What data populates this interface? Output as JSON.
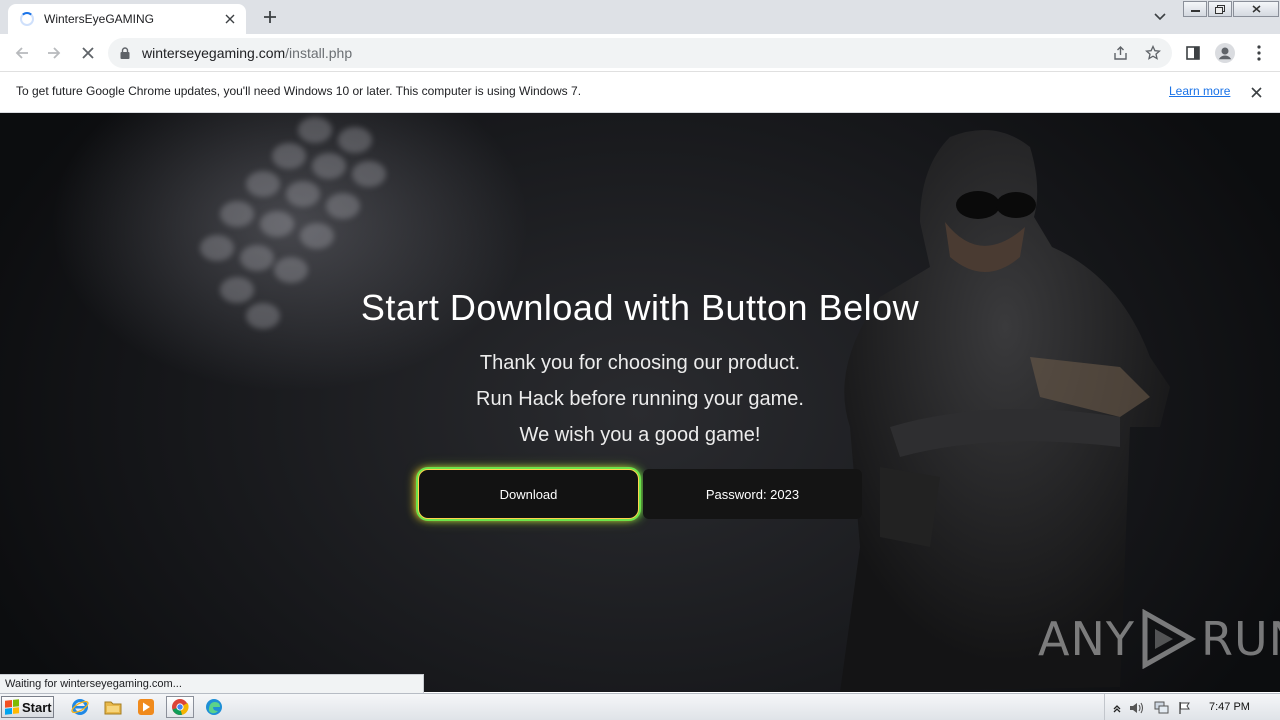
{
  "browser": {
    "tab": {
      "title": "WintersEyeGAMING"
    },
    "address": {
      "host": "winterseyegaming.com",
      "path": "/install.php"
    },
    "infobar": {
      "message": "To get future Google Chrome updates, you'll need Windows 10 or later. This computer is using Windows 7.",
      "link_label": "Learn more"
    },
    "status": "Waiting for winterseyegaming.com..."
  },
  "page": {
    "title": "Start Download with Button Below",
    "lines": [
      "Thank you for choosing our product.",
      "Run Hack before running your game.",
      "We wish you a good game!"
    ],
    "download_label": "Download",
    "password_label": "Password: 2023",
    "watermark_left": "ANY",
    "watermark_right": "RUN"
  },
  "taskbar": {
    "start_label": "Start",
    "clock": "7:47 PM"
  },
  "colors": {
    "tab_strip": "#dee1e6",
    "link": "#1a73e8",
    "download_glow_left": "#ffbe28",
    "download_glow_right": "#5ae646",
    "page_bg": "#151619"
  },
  "icons": [
    "loading-spinner-icon",
    "close-icon",
    "plus-icon",
    "chevron-down-icon",
    "back-arrow-icon",
    "forward-arrow-icon",
    "stop-loading-icon",
    "lock-icon",
    "share-icon",
    "star-icon",
    "side-panel-icon",
    "profile-icon",
    "more-vert-icon",
    "windows-flag-icon",
    "internet-explorer-icon",
    "folder-icon",
    "media-player-icon",
    "chrome-icon",
    "edge-icon",
    "tray-arrow-icon",
    "volume-icon",
    "network-icon",
    "action-center-flag-icon"
  ]
}
